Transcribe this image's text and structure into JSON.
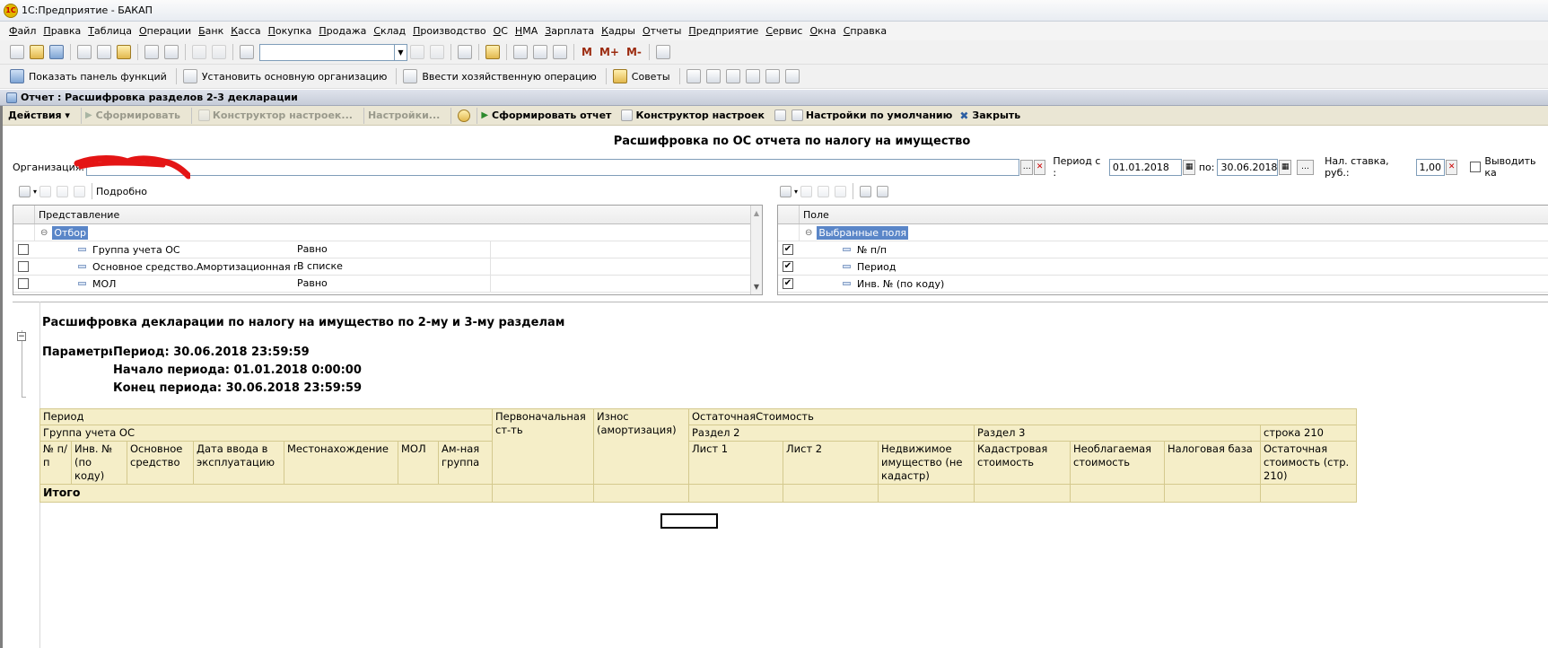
{
  "window": {
    "title": "1С:Предприятие - БАКАП",
    "logo": "1С"
  },
  "menu": [
    "Файл",
    "Правка",
    "Таблица",
    "Операции",
    "Банк",
    "Касса",
    "Покупка",
    "Продажа",
    "Склад",
    "Производство",
    "ОС",
    "НМА",
    "Зарплата",
    "Кадры",
    "Отчеты",
    "Предприятие",
    "Сервис",
    "Окна",
    "Справка"
  ],
  "toolbar1": {
    "mem_buttons": [
      "M",
      "M+",
      "M-"
    ]
  },
  "toolbar2": {
    "show_panel": "Показать панель функций",
    "set_org": "Установить основную организацию",
    "enter_op": "Ввести хозяйственную операцию",
    "tips": "Советы"
  },
  "doc": {
    "title": "Отчет : Расшифровка разделов 2-3 декларации",
    "actions": {
      "actions": "Действия",
      "form_disabled": "Сформировать",
      "constructor_disabled": "Конструктор настроек...",
      "settings_disabled": "Настройки...",
      "form": "Сформировать отчет",
      "constructor": "Конструктор настроек",
      "defaults": "Настройки по умолчанию",
      "close": "Закрыть"
    },
    "heading": "Расшифровка по ОС отчета по налогу на имущество",
    "org_label": "Организация:",
    "org_value": "\"",
    "period_from_label": "Период с :",
    "period_from": "01.01.2018",
    "period_to_label": "по:",
    "period_to": "30.06.2018",
    "rate_label": "Нал. ставка, руб.:",
    "rate_value": "1,00",
    "output_label": "Выводить ка",
    "detail_label": "Подробно"
  },
  "filter_grid": {
    "header": "Представление",
    "group": "Отбор",
    "rows": [
      {
        "name": "Группа учета ОС",
        "cond": "Равно"
      },
      {
        "name": "Основное средство.Амортизационная гр...",
        "cond": "В списке"
      },
      {
        "name": "МОЛ",
        "cond": "Равно"
      }
    ]
  },
  "fields_grid": {
    "header": "Поле",
    "group": "Выбранные поля",
    "rows": [
      "№ п/п",
      "Период",
      "Инв. № (по коду)"
    ]
  },
  "report": {
    "title": "Расшифровка декларации по налогу на имущество по 2-му и 3-му разделам",
    "params_label": "Параметры:",
    "period": "Период: 30.06.2018 23:59:59",
    "start": "Начало периода: 01.01.2018 0:00:00",
    "end": "Конец периода: 30.06.2018 23:59:59",
    "table": {
      "period": "Период",
      "group": "Группа учета ОС",
      "num": "№ п/п",
      "inv": "Инв. № (по коду)",
      "asset": "Основное средство",
      "date": "Дата ввода в эксплуатацию",
      "location": "Местонахождение",
      "mol": "МОЛ",
      "amgroup": "Ам-ная группа",
      "initial": "Первоначальная ст-ть",
      "wear": "Износ (амортизация)",
      "residual": "ОстаточнаяСтоимость",
      "sec2": "Раздел 2",
      "sheet1": "Лист 1",
      "sheet2": "Лист 2",
      "realty": "Недвижимое имущество (не кадастр)",
      "sec3": "Раздел 3",
      "cadastral": "Кадастровая стоимость",
      "nontax": "Необлагаемая стоимость",
      "base": "Налоговая база",
      "row210": "строка 210",
      "resid210": "Остаточная стоимость (стр. 210)",
      "total": "Итого"
    }
  }
}
